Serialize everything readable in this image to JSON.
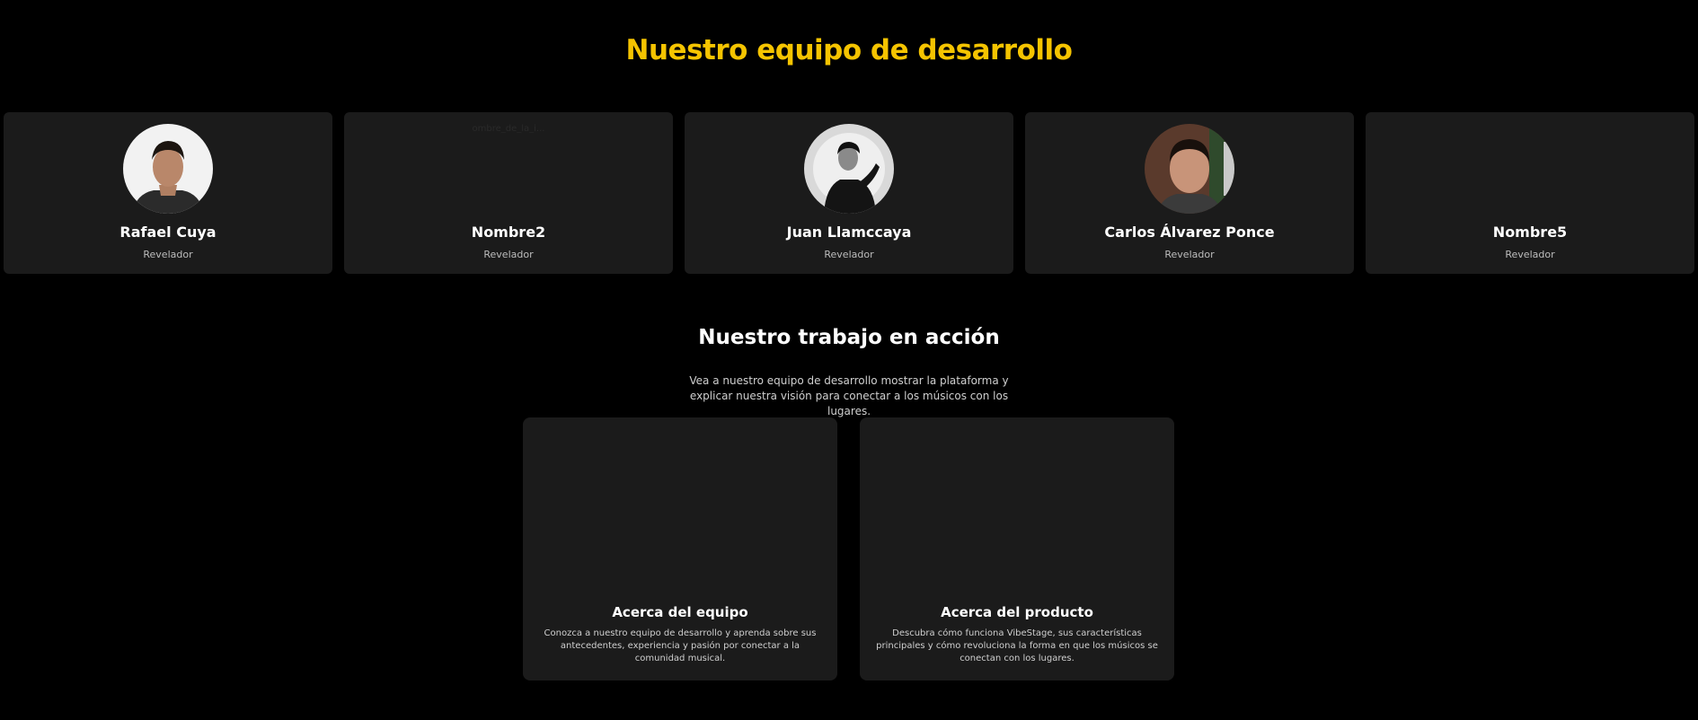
{
  "team": {
    "title": "Nuestro equipo de desarrollo",
    "members": [
      {
        "name": "Rafael Cuya",
        "role": "Revelador",
        "avatar": "photo",
        "avatar_alt": ""
      },
      {
        "name": "Nombre2",
        "role": "Revelador",
        "avatar": "broken",
        "avatar_alt": "ombre_de_la_i..."
      },
      {
        "name": "Juan Llamccaya",
        "role": "Revelador",
        "avatar": "photo",
        "avatar_alt": ""
      },
      {
        "name": "Carlos Álvarez Ponce",
        "role": "Revelador",
        "avatar": "photo",
        "avatar_alt": ""
      },
      {
        "name": "Nombre5",
        "role": "Revelador",
        "avatar": "none",
        "avatar_alt": ""
      }
    ]
  },
  "work": {
    "title": "Nuestro trabajo en acción",
    "subtitle": "Vea a nuestro equipo de desarrollo mostrar la plataforma y explicar nuestra visión para conectar a los músicos con los lugares.",
    "videos": [
      {
        "title": "Acerca del equipo",
        "description": "Conozca a nuestro equipo de desarrollo y aprenda sobre sus antecedentes, experiencia y pasión por conectar a la comunidad musical."
      },
      {
        "title": "Acerca del producto",
        "description": "Descubra cómo funciona VibeStage, sus características principales y cómo revoluciona la forma en que los músicos se conectan con los lugares."
      }
    ]
  },
  "colors": {
    "background": "#000000",
    "card": "#1b1b1b",
    "accent": "#f5c400",
    "text": "#ffffff",
    "muted": "#bdbdbd"
  }
}
